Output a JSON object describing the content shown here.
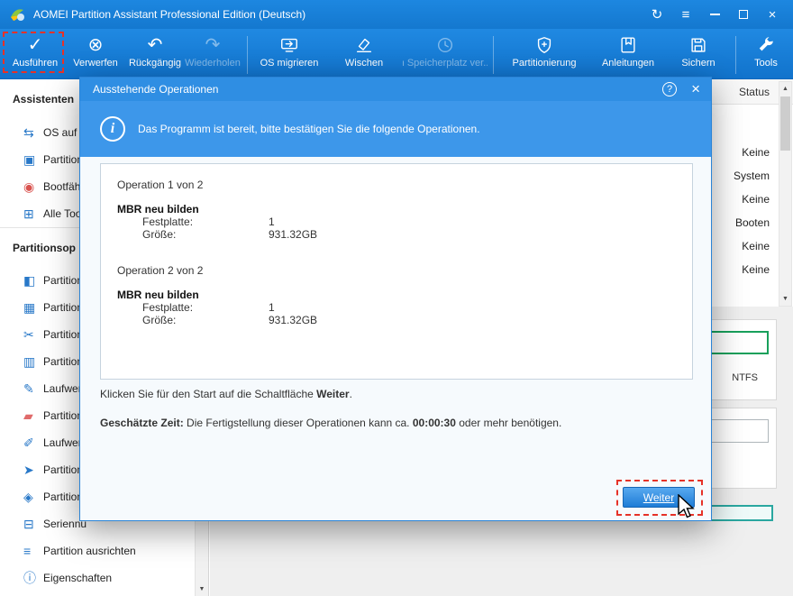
{
  "colors": {
    "accent_blue": "#1b7fd9",
    "annotation_red": "#e63228",
    "partition_green": "#18a05b",
    "partition_teal": "#2aa7a0"
  },
  "icons": {
    "sync": "↻",
    "menu": "≡",
    "close": "×",
    "check": "✓",
    "discard": "⊗",
    "undo": "↶",
    "redo": "↷",
    "help": "?",
    "info": "i",
    "scroll_up": "▲",
    "scroll_down": "▼"
  },
  "titlebar": {
    "title": "AOMEI Partition Assistant Professional Edition (Deutsch)"
  },
  "toolbar": {
    "buttons": [
      {
        "label": "Ausführen"
      },
      {
        "label": "Verwerfen"
      },
      {
        "label": "Rückgängig"
      },
      {
        "label": "Wiederholen"
      },
      {
        "label": "OS migrieren"
      },
      {
        "label": "Wischen"
      },
      {
        "label": "n Speicherplatz ver..."
      },
      {
        "label": "Partitionierung"
      },
      {
        "label": "Anleitungen"
      },
      {
        "label": "Sichern"
      },
      {
        "label": "Tools"
      }
    ]
  },
  "sidebar": {
    "sections": [
      {
        "header": "Assistenten",
        "items": [
          {
            "icon": "⇆",
            "label": "OS auf S"
          },
          {
            "icon": "▣",
            "label": "Partition"
          },
          {
            "icon": "◉",
            "label": "Bootfähi"
          },
          {
            "icon": "⊞",
            "label": "Alle Tool"
          }
        ]
      },
      {
        "header": "Partitionsop",
        "items": [
          {
            "icon": "◧",
            "label": "Partition"
          },
          {
            "icon": "▦",
            "label": "Partition"
          },
          {
            "icon": "✂",
            "label": "Partition"
          },
          {
            "icon": "▥",
            "label": "Partition"
          },
          {
            "icon": "✎",
            "label": "Laufwerk"
          },
          {
            "icon": "▰",
            "label": "Partition"
          },
          {
            "icon": "✐",
            "label": "Laufwerk"
          },
          {
            "icon": "➤",
            "label": "Partition"
          },
          {
            "icon": "◈",
            "label": "Partition"
          },
          {
            "icon": "⊟",
            "label": "Seriennu"
          },
          {
            "icon": "≡",
            "label": "Partition ausrichten"
          },
          {
            "icon": "ⓘ",
            "label": "Eigenschaften"
          }
        ]
      }
    ]
  },
  "main": {
    "status_header": "Status",
    "status_values": [
      "Keine",
      "System",
      "Keine",
      "Booten",
      "Keine",
      "Keine"
    ],
    "fs_label": "NTFS"
  },
  "dialog": {
    "title": "Ausstehende Operationen",
    "info_text": "Das Programm ist bereit, bitte bestätigen Sie die folgende Operationen.",
    "operations": [
      {
        "header": "Operation 1 von 2",
        "name": "MBR neu bilden",
        "disk_label": "Festplatte:",
        "disk_value": "1",
        "size_label": "Größe:",
        "size_value": "931.32GB"
      },
      {
        "header": "Operation 2 von 2",
        "name": "MBR neu bilden",
        "disk_label": "Festplatte:",
        "disk_value": "1",
        "size_label": "Größe:",
        "size_value": "931.32GB"
      }
    ],
    "note": {
      "prefix": "Klicken Sie für den Start auf die Schaltfläche ",
      "bold": "Weiter",
      "suffix": "."
    },
    "estimate": {
      "label": "Geschätzte Zeit:",
      "mid": " Die Fertigstellung dieser Operationen kann ca. ",
      "time": "00:00:30",
      "suffix": " oder mehr benötigen."
    },
    "buttons": {
      "next": "Weiter"
    }
  }
}
